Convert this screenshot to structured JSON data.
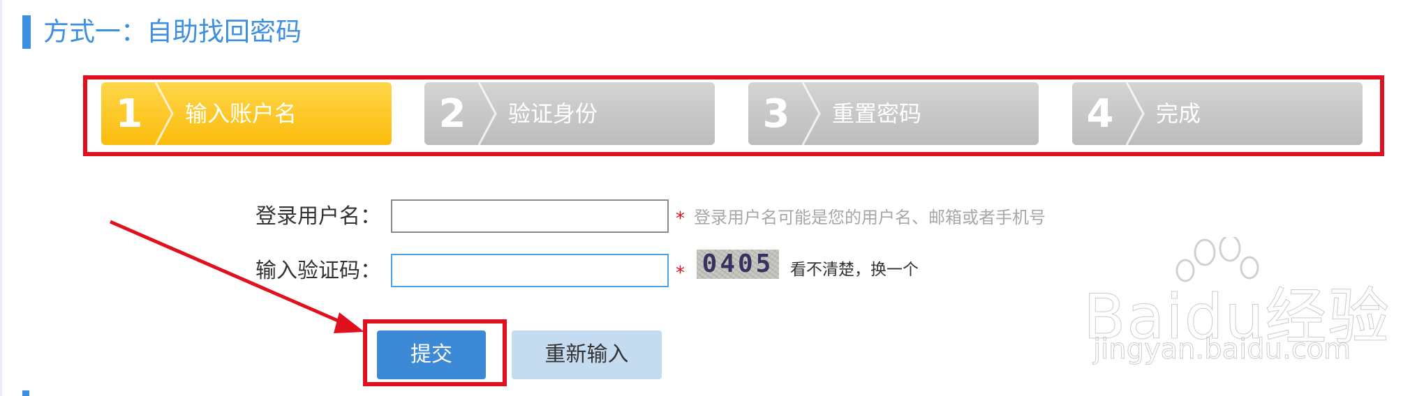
{
  "section": {
    "title": "方式一：自助找回密码"
  },
  "steps": [
    {
      "num": "1",
      "label": "输入账户名",
      "active": true
    },
    {
      "num": "2",
      "label": "验证身份",
      "active": false
    },
    {
      "num": "3",
      "label": "重置密码",
      "active": false
    },
    {
      "num": "4",
      "label": "完成",
      "active": false
    }
  ],
  "form": {
    "username": {
      "label": "登录用户名：",
      "value": "",
      "required_mark": "*",
      "hint": "登录用户名可能是您的用户名、邮箱或者手机号"
    },
    "captcha": {
      "label": "输入验证码：",
      "value": "",
      "required_mark": "*",
      "image_text": "0405",
      "refresh_text": "看不清楚，换一个"
    }
  },
  "buttons": {
    "submit": "提交",
    "reset": "重新输入"
  },
  "watermark": {
    "main": "Baidu经验",
    "sub": "jingyan.baidu.com"
  },
  "colors": {
    "accent": "#3d8fe0",
    "active_step": "#fbbc0c",
    "inactive_step": "#c4c4c4",
    "annotation": "#e0101e"
  }
}
